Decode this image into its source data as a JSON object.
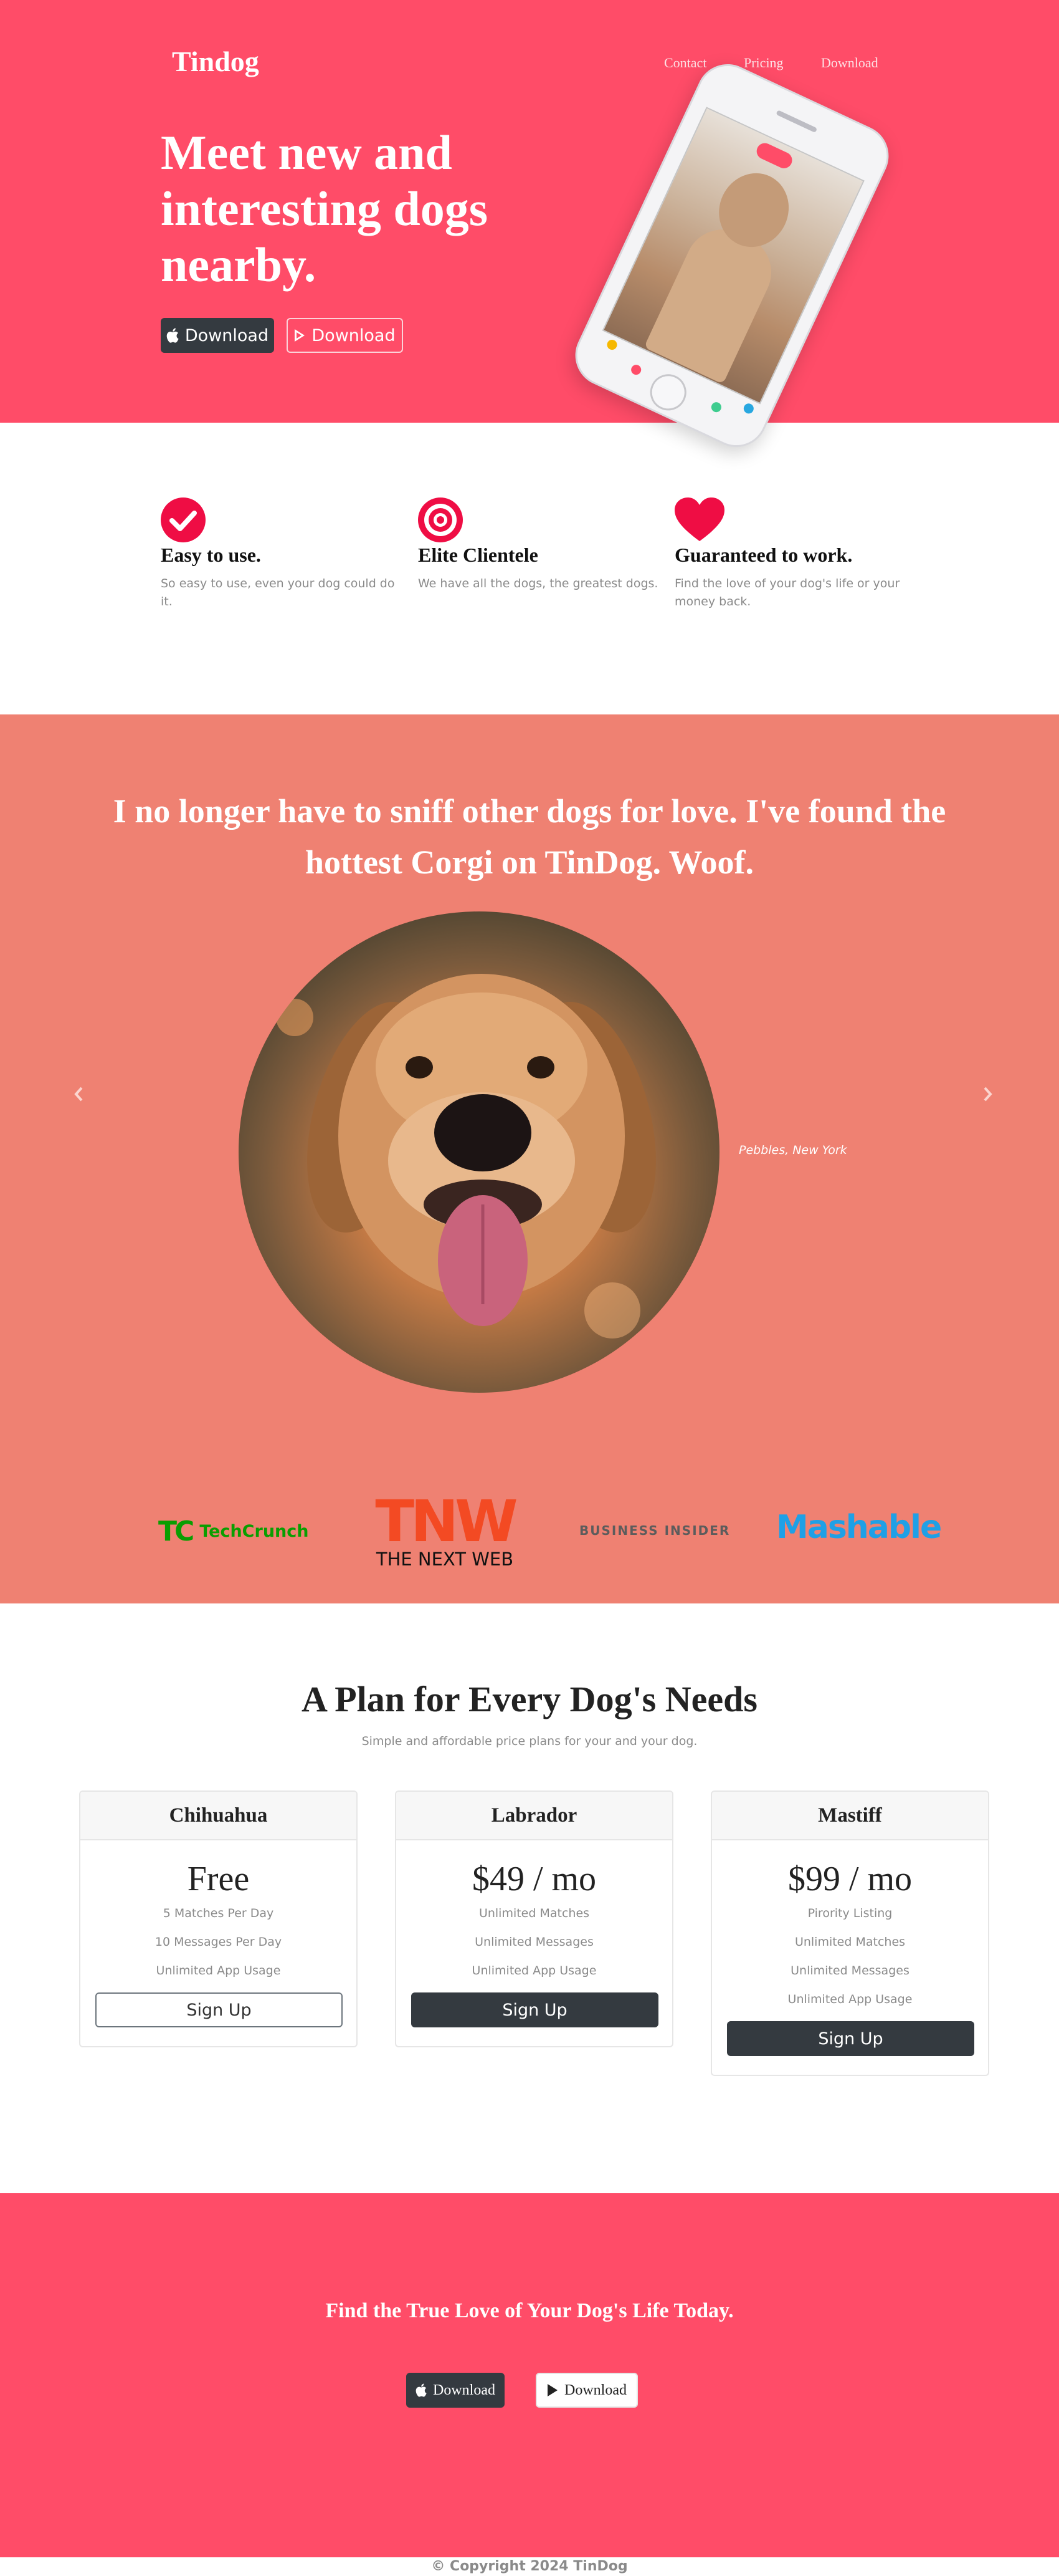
{
  "colors": {
    "hero_bg": "#ff4c68",
    "testimonial_bg": "#ef8172",
    "dark_button": "#343a40",
    "feature_icon_red": "#ef0d44"
  },
  "header": {
    "brand": "Tindog",
    "nav": [
      "Contact",
      "Pricing",
      "Download"
    ]
  },
  "hero": {
    "title": "Meet new and interesting dogs nearby.",
    "apple_button": {
      "icon": "apple-icon",
      "label": "Download"
    },
    "play_button": {
      "icon": "play-store-icon",
      "label": "Download"
    }
  },
  "features": [
    {
      "icon": "check-circle-icon",
      "title": "Easy to use.",
      "text": "So easy to use, even your dog could do it."
    },
    {
      "icon": "bullseye-icon",
      "title": "Elite Clientele",
      "text": "We have all the dogs, the greatest dogs."
    },
    {
      "icon": "heart-icon",
      "title": "Guaranteed to work.",
      "text": "Find the love of your dog's life or your money back."
    }
  ],
  "testimonial": {
    "quote": "I no longer have to sniff other dogs for love. I've found the hottest Corgi on TinDog. Woof.",
    "caption": "Pebbles, New York",
    "prev_icon": "chevron-left-icon",
    "next_icon": "chevron-right-icon"
  },
  "press": {
    "techcrunch_mark": "TC",
    "techcrunch": "TechCrunch",
    "tnw_mark": "TNW",
    "tnw": "THE NEXT WEB",
    "business_insider": "BUSINESS INSIDER",
    "mashable": "Mashable"
  },
  "pricing": {
    "title": "A Plan for Every Dog's Needs",
    "subtitle": "Simple and affordable price plans for your and your dog.",
    "plans": [
      {
        "name": "Chihuahua",
        "price": "Free",
        "features": [
          "5 Matches Per Day",
          "10 Messages Per Day",
          "Unlimited App Usage"
        ],
        "button": "Sign Up",
        "style": "outline"
      },
      {
        "name": "Labrador",
        "price": "$49 / mo",
        "features": [
          "Unlimited Matches",
          "Unlimited Messages",
          "Unlimited App Usage"
        ],
        "button": "Sign Up",
        "style": "dark"
      },
      {
        "name": "Mastiff",
        "price": "$99 / mo",
        "features": [
          "Pirority Listing",
          "Unlimited Matches",
          "Unlimited Messages",
          "Unlimited App Usage"
        ],
        "button": "Sign Up",
        "style": "dark"
      }
    ]
  },
  "cta": {
    "title": "Find the True Love of Your Dog's Life Today.",
    "apple_button": {
      "icon": "apple-icon",
      "label": "Download"
    },
    "play_button": {
      "icon": "play-store-icon",
      "label": "Download"
    }
  },
  "footer": {
    "copyright": "© Copyright 2024 TinDog"
  }
}
